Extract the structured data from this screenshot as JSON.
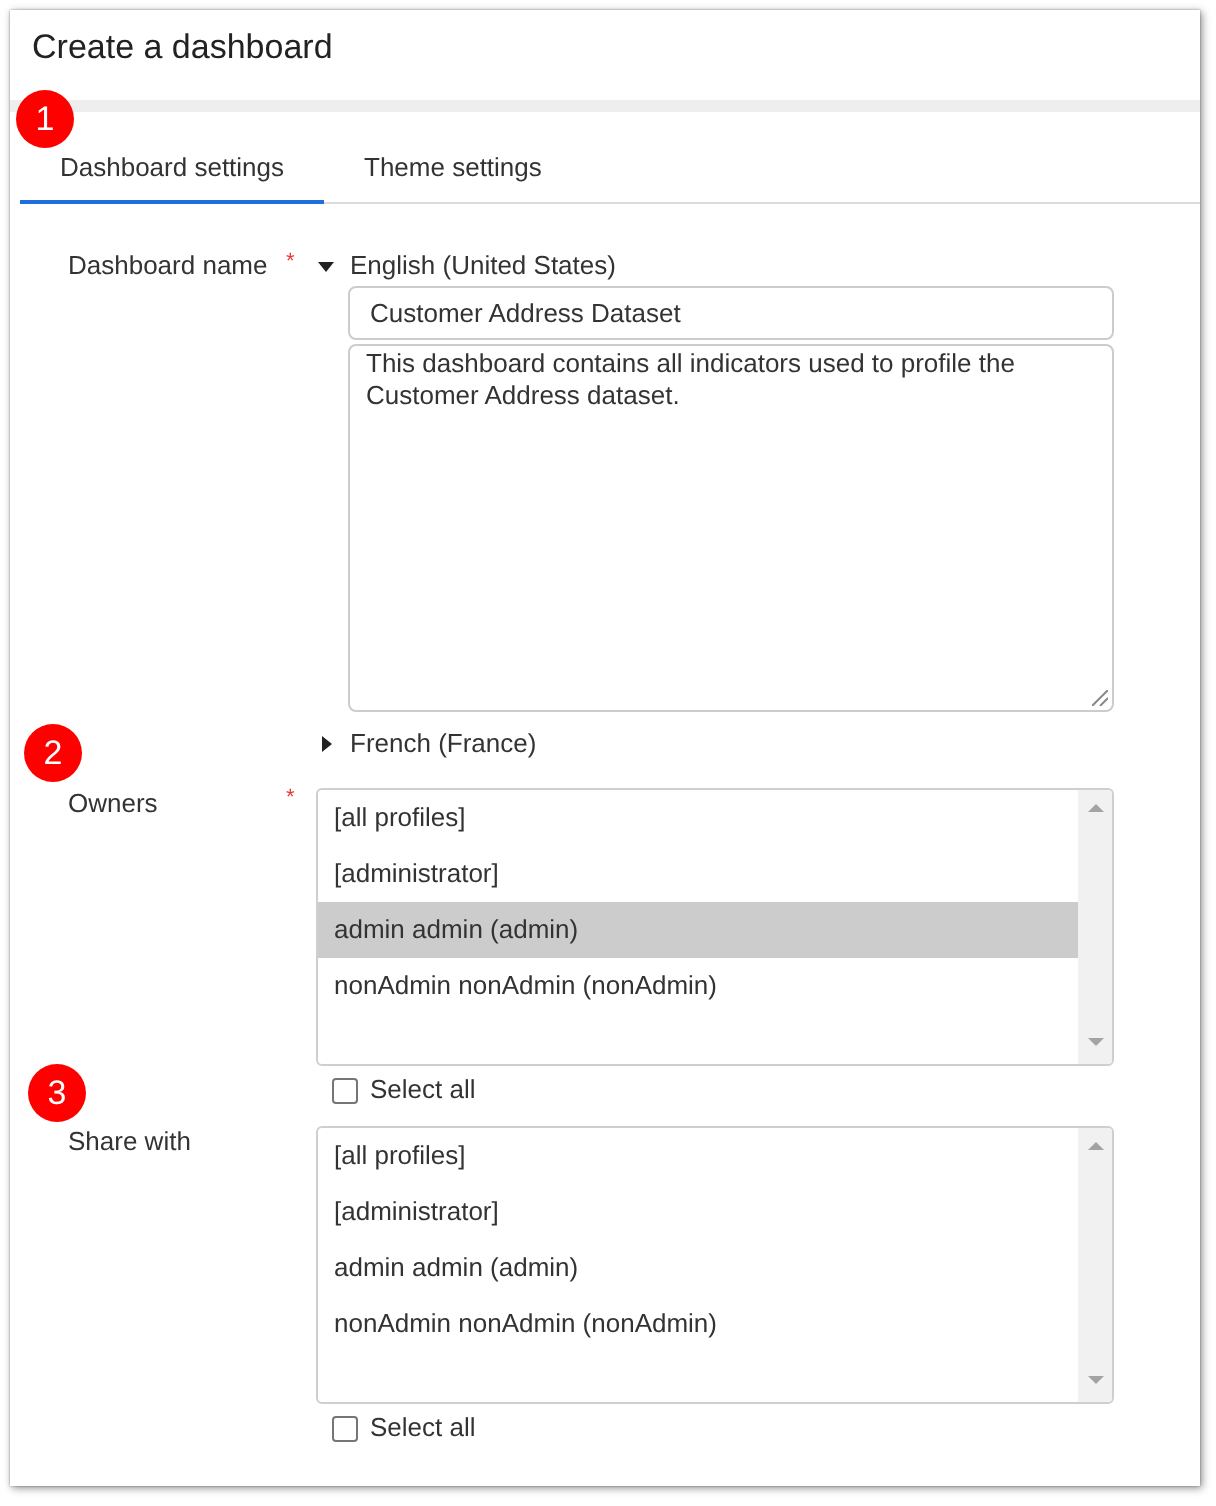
{
  "dialog": {
    "title": "Create a dashboard"
  },
  "tab_bar": {
    "callout": "1",
    "tabs": [
      {
        "label": "Dashboard settings",
        "selected": true
      },
      {
        "label": "Theme settings",
        "selected": false
      }
    ]
  },
  "dashboard_name": {
    "label": "Dashboard name",
    "required_mark": "*",
    "languages": [
      {
        "label": "English (United States)",
        "expanded": true,
        "name": "Customer Address Dataset",
        "description": "This dashboard contains all indicators used to profile the Customer Address dataset."
      },
      {
        "label": "French (France)",
        "expanded": false
      }
    ]
  },
  "owners": {
    "callout": "2",
    "label": "Owners",
    "required_mark": "*",
    "options": [
      {
        "label": "[all profiles]",
        "selected": false
      },
      {
        "label": "[administrator]",
        "selected": false
      },
      {
        "label": "admin admin (admin)",
        "selected": true
      },
      {
        "label": "nonAdmin nonAdmin (nonAdmin)",
        "selected": false
      }
    ],
    "select_all": {
      "label": "Select all",
      "checked": false
    }
  },
  "share_with": {
    "callout": "3",
    "label": "Share with",
    "options": [
      {
        "label": "[all profiles]",
        "selected": false
      },
      {
        "label": "[administrator]",
        "selected": false
      },
      {
        "label": "admin admin (admin)",
        "selected": false
      },
      {
        "label": "nonAdmin nonAdmin (nonAdmin)",
        "selected": false
      }
    ],
    "select_all": {
      "label": "Select all",
      "checked": false
    }
  }
}
